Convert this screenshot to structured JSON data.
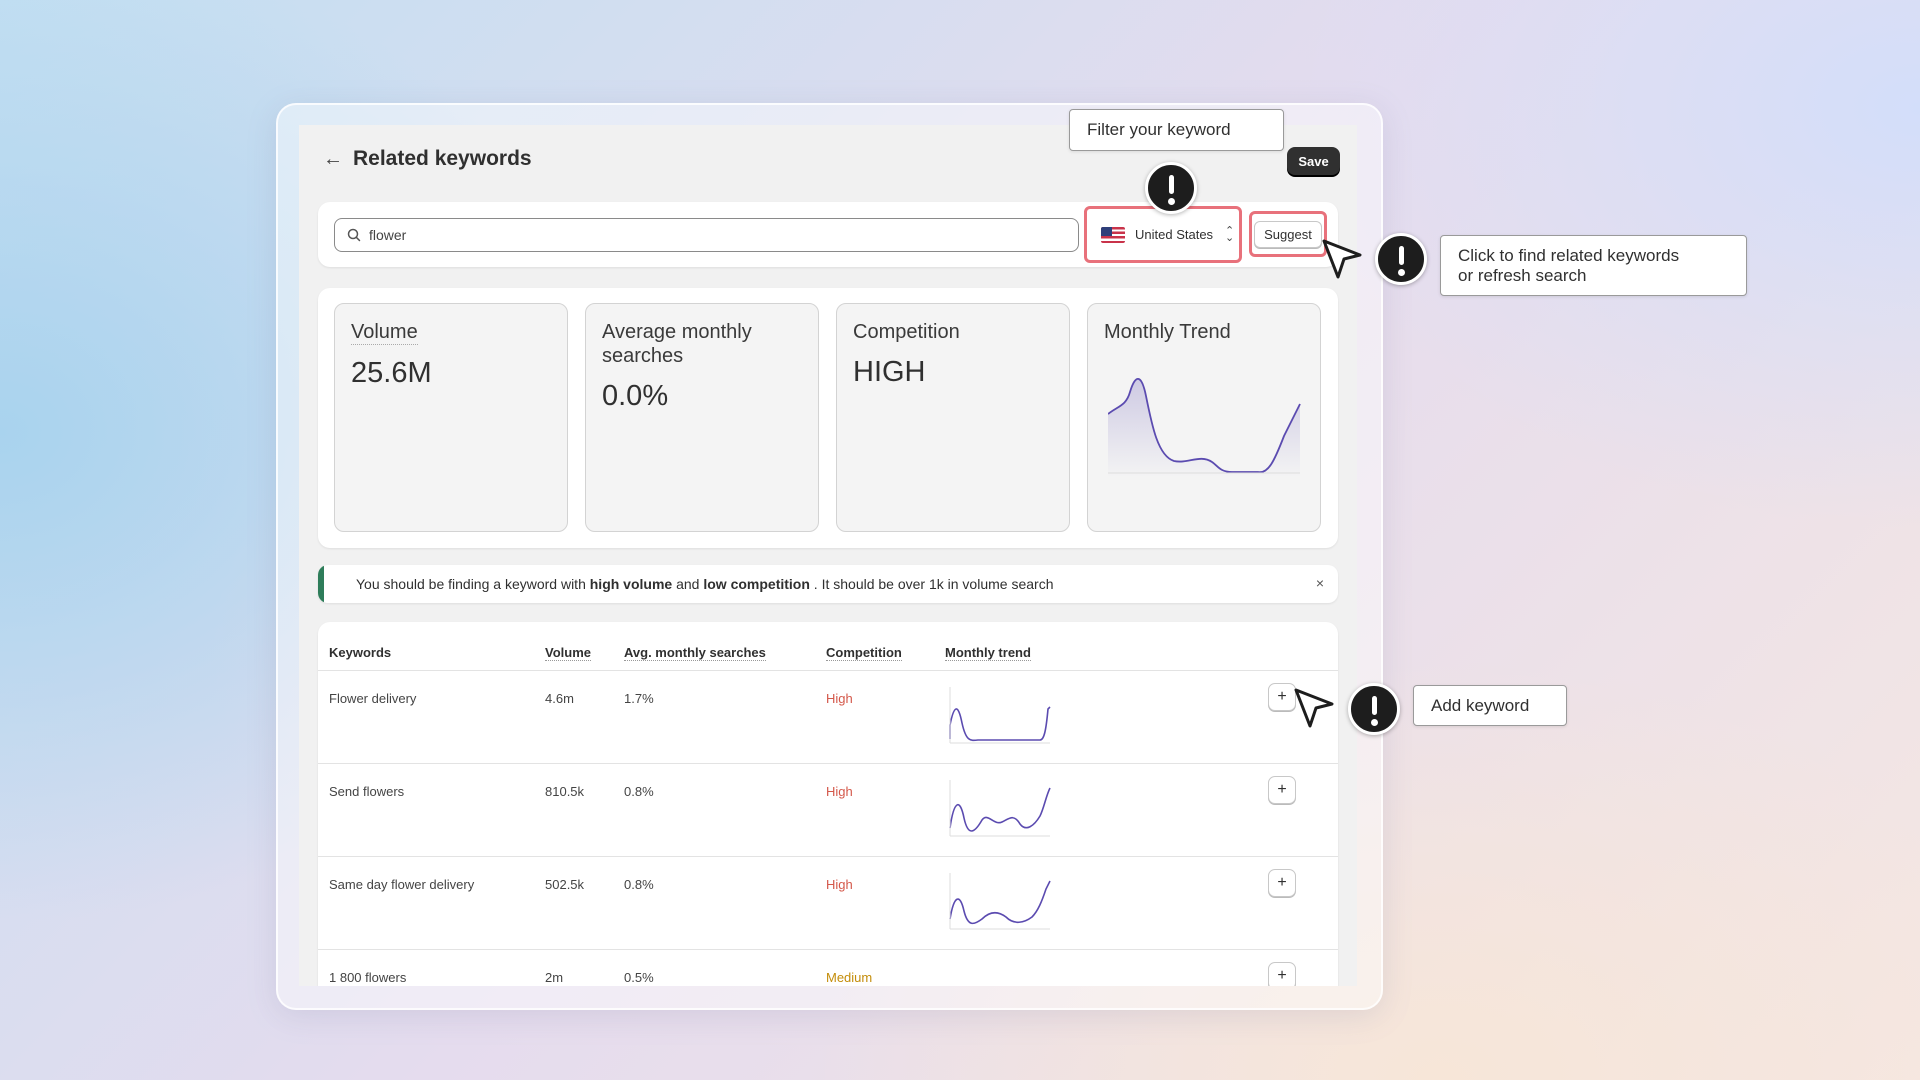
{
  "header": {
    "title": "Related keywords",
    "save_label": "Save"
  },
  "search": {
    "value": "flower",
    "country": "United States",
    "suggest_label": "Suggest"
  },
  "stats": {
    "volume_label": "Volume",
    "volume_value": "25.6M",
    "avg_label": "Average monthly searches",
    "avg_value": "0.0%",
    "competition_label": "Competition",
    "competition_value": "HIGH",
    "trend_label": "Monthly Trend"
  },
  "banner": {
    "part1": "You should be finding a keyword with ",
    "bold1": "high volume",
    "part2": " and ",
    "bold2": "low competition",
    "part3": " . It should be over 1k in volume search",
    "close": "×"
  },
  "table": {
    "headers": [
      "Keywords",
      "Volume",
      "Avg. monthly searches",
      "Competition",
      "Monthly trend"
    ],
    "rows": [
      {
        "keyword": "Flower delivery",
        "volume": "4.6m",
        "avg": "1.7%",
        "competition": "High",
        "add": "+"
      },
      {
        "keyword": "Send flowers",
        "volume": "810.5k",
        "avg": "0.8%",
        "competition": "High",
        "add": "+"
      },
      {
        "keyword": "Same day flower delivery",
        "volume": "502.5k",
        "avg": "0.8%",
        "competition": "High",
        "add": "+"
      },
      {
        "keyword": "1 800 flowers",
        "volume": "2m",
        "avg": "0.5%",
        "competition": "Medium",
        "add": "+"
      }
    ]
  },
  "tooltips": {
    "filter": "Filter your keyword",
    "suggest_line1": "Click to find related keywords",
    "suggest_line2": "or refresh search",
    "add": "Add keyword"
  },
  "colors": {
    "accent_save": "#303030",
    "highlight": "#e8717b",
    "high": "#d4584a",
    "medium": "#c48d0a",
    "banner_bar": "#2e7d5a",
    "trend": "#5b4bb0"
  },
  "icons": [
    "back-arrow-icon",
    "search-icon",
    "us-flag-icon",
    "updown-chevron-icon",
    "close-icon",
    "plus-icon",
    "alert-icon",
    "cursor-icon"
  ]
}
